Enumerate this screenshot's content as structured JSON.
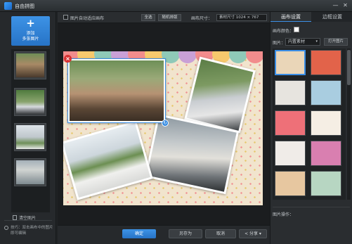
{
  "window": {
    "title": "自由拼图"
  },
  "left_panel": {
    "add_button": "添加\n多张图片",
    "clear_button": "清空图片",
    "tip": "技巧：双击画布中的图片即可编辑"
  },
  "toolbar": {
    "auto_fit_label": "图片自动适应画布",
    "select_all": "全选",
    "random_layout": "随机排版",
    "canvas_size_label": "画布尺寸：",
    "canvas_size_value": "素材尺寸 1024 × 767"
  },
  "bottom_bar": {
    "confirm": "确定",
    "save_as": "另存为",
    "cancel": "取消",
    "share": "分享"
  },
  "right_panel": {
    "tabs": [
      "画布设置",
      "边框设置"
    ],
    "active_tab": 0,
    "bg_color_label": "画布颜色：",
    "bg_color": "#ffffff",
    "image_label": "图片：",
    "image_select": "内置素材",
    "open_image": "打开图片",
    "image_ops_label": "图片操作："
  },
  "colors": {
    "accent": "#3a8ee6",
    "delete": "#d73232",
    "canvas_bg": "#f1e4cd"
  },
  "icons": [
    "app-icon",
    "minimize-icon",
    "close-icon",
    "plus-icon",
    "trash-icon",
    "info-icon",
    "delete-photo-icon",
    "rotate-icon",
    "share-icon",
    "dropdown-arrow-icon"
  ]
}
